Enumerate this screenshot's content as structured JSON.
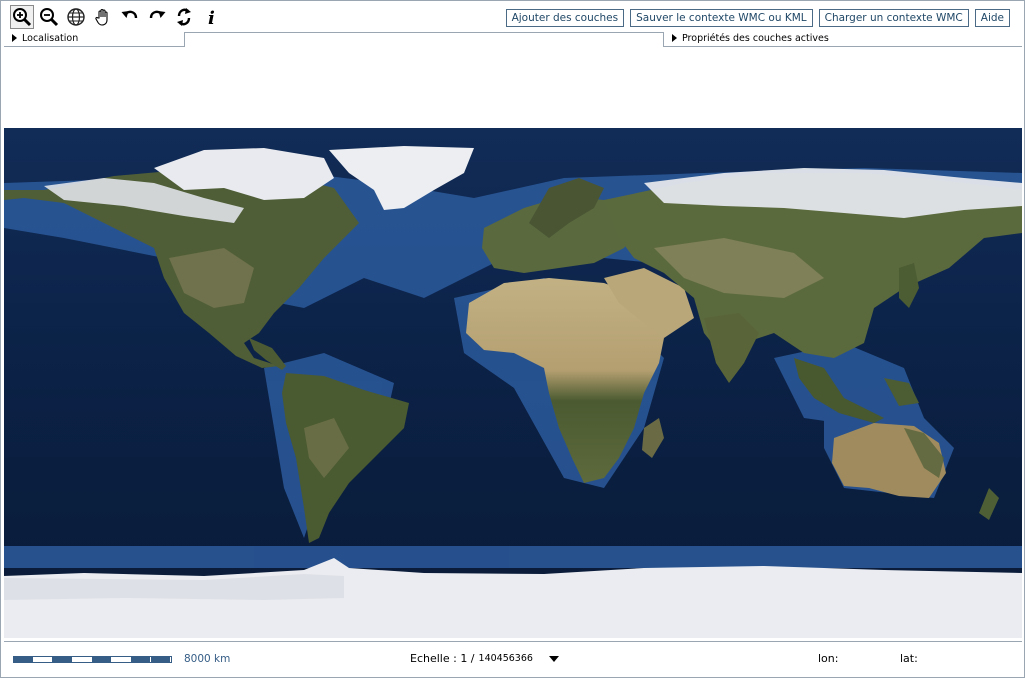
{
  "toolbar": {
    "tools": [
      {
        "name": "zoom-in",
        "active": true
      },
      {
        "name": "zoom-out"
      },
      {
        "name": "full-extent"
      },
      {
        "name": "pan"
      },
      {
        "name": "previous-view"
      },
      {
        "name": "next-view"
      },
      {
        "name": "refresh"
      },
      {
        "name": "info",
        "glyph": "i"
      }
    ]
  },
  "top_buttons": {
    "add_layers": "Ajouter des couches",
    "save_context": "Sauver le contexte WMC ou KML",
    "load_context": "Charger un contexte WMC",
    "help": "Aide"
  },
  "tabs": {
    "left": "Localisation",
    "right": "Propriétés des couches actives"
  },
  "colors": {
    "border": "#9aa6b2",
    "button_border": "#4a6a86",
    "button_text": "#1f4766",
    "scale": "#355d86",
    "ocean_deep": "#0a1f3f",
    "ocean_shelf": "#2d5a9e",
    "land_green": "#4f5e36",
    "land_desert": "#b8a57a",
    "ice": "#e8eaef"
  },
  "status": {
    "scale_distance": "8000 km",
    "echelle_label": "Echelle : 1 /",
    "echelle_value": "140456366",
    "lon_label": "lon:",
    "lat_label": "lat:"
  }
}
